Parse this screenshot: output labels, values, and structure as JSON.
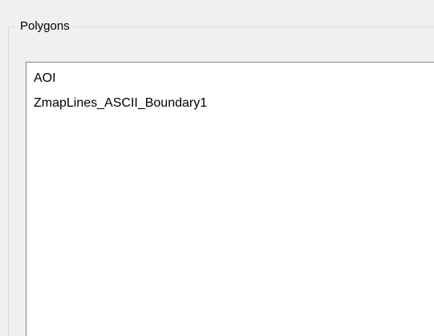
{
  "groupbox": {
    "title": "Polygons"
  },
  "polygons_list": {
    "items": [
      {
        "label": "AOI"
      },
      {
        "label": "ZmapLines_ASCII_Boundary1"
      }
    ]
  }
}
